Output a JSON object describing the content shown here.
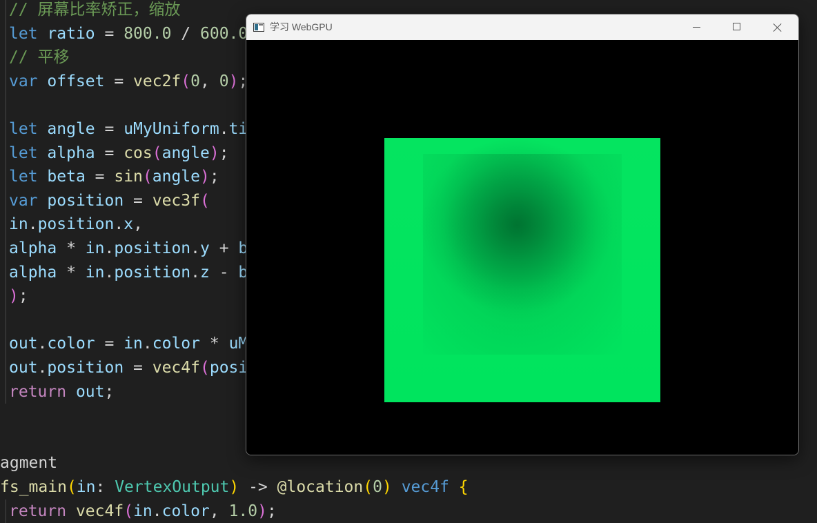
{
  "editor": {
    "lines": [
      {
        "guide": true,
        "tokens": [
          {
            "t": "// 屏幕比率矫正，缩放",
            "c": "cm"
          }
        ]
      },
      {
        "guide": true,
        "tokens": [
          {
            "t": "let",
            "c": "kw"
          },
          {
            "t": " ",
            "c": "plain"
          },
          {
            "t": "ratio",
            "c": "var"
          },
          {
            "t": " = ",
            "c": "op"
          },
          {
            "t": "800.0",
            "c": "num"
          },
          {
            "t": " / ",
            "c": "op"
          },
          {
            "t": "600.0",
            "c": "num"
          }
        ]
      },
      {
        "guide": true,
        "tokens": [
          {
            "t": "// 平移",
            "c": "cm"
          }
        ]
      },
      {
        "guide": true,
        "tokens": [
          {
            "t": "var",
            "c": "kw"
          },
          {
            "t": " ",
            "c": "plain"
          },
          {
            "t": "offset",
            "c": "var"
          },
          {
            "t": " = ",
            "c": "op"
          },
          {
            "t": "vec2f",
            "c": "fn"
          },
          {
            "t": "(",
            "c": "br2"
          },
          {
            "t": "0",
            "c": "num"
          },
          {
            "t": ", ",
            "c": "op"
          },
          {
            "t": "0",
            "c": "num"
          },
          {
            "t": ")",
            "c": "br2"
          },
          {
            "t": ";",
            "c": "op"
          }
        ]
      },
      {
        "guide": true,
        "tokens": []
      },
      {
        "guide": true,
        "tokens": [
          {
            "t": "let",
            "c": "kw"
          },
          {
            "t": " ",
            "c": "plain"
          },
          {
            "t": "angle",
            "c": "var"
          },
          {
            "t": " = ",
            "c": "op"
          },
          {
            "t": "uMyUniform",
            "c": "var"
          },
          {
            "t": ".",
            "c": "op"
          },
          {
            "t": "ti",
            "c": "var"
          }
        ]
      },
      {
        "guide": true,
        "tokens": [
          {
            "t": "let",
            "c": "kw"
          },
          {
            "t": " ",
            "c": "plain"
          },
          {
            "t": "alpha",
            "c": "var"
          },
          {
            "t": " = ",
            "c": "op"
          },
          {
            "t": "cos",
            "c": "fn"
          },
          {
            "t": "(",
            "c": "br2"
          },
          {
            "t": "angle",
            "c": "var"
          },
          {
            "t": ")",
            "c": "br2"
          },
          {
            "t": ";",
            "c": "op"
          }
        ]
      },
      {
        "guide": true,
        "tokens": [
          {
            "t": "let",
            "c": "kw"
          },
          {
            "t": " ",
            "c": "plain"
          },
          {
            "t": "beta",
            "c": "var"
          },
          {
            "t": " = ",
            "c": "op"
          },
          {
            "t": "sin",
            "c": "fn"
          },
          {
            "t": "(",
            "c": "br2"
          },
          {
            "t": "angle",
            "c": "var"
          },
          {
            "t": ")",
            "c": "br2"
          },
          {
            "t": ";",
            "c": "op"
          }
        ]
      },
      {
        "guide": true,
        "tokens": [
          {
            "t": "var",
            "c": "kw"
          },
          {
            "t": " ",
            "c": "plain"
          },
          {
            "t": "position",
            "c": "var"
          },
          {
            "t": " = ",
            "c": "op"
          },
          {
            "t": "vec3f",
            "c": "fn"
          },
          {
            "t": "(",
            "c": "br2"
          }
        ]
      },
      {
        "guide": true,
        "tokens": [
          {
            "t": "in",
            "c": "var"
          },
          {
            "t": ".",
            "c": "op"
          },
          {
            "t": "position",
            "c": "var"
          },
          {
            "t": ".",
            "c": "op"
          },
          {
            "t": "x",
            "c": "var"
          },
          {
            "t": ",",
            "c": "op"
          }
        ]
      },
      {
        "guide": true,
        "tokens": [
          {
            "t": "alpha",
            "c": "var"
          },
          {
            "t": " * ",
            "c": "op"
          },
          {
            "t": "in",
            "c": "var"
          },
          {
            "t": ".",
            "c": "op"
          },
          {
            "t": "position",
            "c": "var"
          },
          {
            "t": ".",
            "c": "op"
          },
          {
            "t": "y",
            "c": "var"
          },
          {
            "t": " + ",
            "c": "op"
          },
          {
            "t": "b",
            "c": "var"
          }
        ]
      },
      {
        "guide": true,
        "tokens": [
          {
            "t": "alpha",
            "c": "var"
          },
          {
            "t": " * ",
            "c": "op"
          },
          {
            "t": "in",
            "c": "var"
          },
          {
            "t": ".",
            "c": "op"
          },
          {
            "t": "position",
            "c": "var"
          },
          {
            "t": ".",
            "c": "op"
          },
          {
            "t": "z",
            "c": "var"
          },
          {
            "t": " - ",
            "c": "op"
          },
          {
            "t": "b",
            "c": "var"
          }
        ]
      },
      {
        "guide": true,
        "tokens": [
          {
            "t": ")",
            "c": "br2"
          },
          {
            "t": ";",
            "c": "op"
          }
        ]
      },
      {
        "guide": true,
        "tokens": []
      },
      {
        "guide": true,
        "tokens": [
          {
            "t": "out",
            "c": "var"
          },
          {
            "t": ".",
            "c": "op"
          },
          {
            "t": "color",
            "c": "var"
          },
          {
            "t": " = ",
            "c": "op"
          },
          {
            "t": "in",
            "c": "var"
          },
          {
            "t": ".",
            "c": "op"
          },
          {
            "t": "color",
            "c": "var"
          },
          {
            "t": " * ",
            "c": "op"
          },
          {
            "t": "uM",
            "c": "var"
          }
        ]
      },
      {
        "guide": true,
        "tokens": [
          {
            "t": "out",
            "c": "var"
          },
          {
            "t": ".",
            "c": "op"
          },
          {
            "t": "position",
            "c": "var"
          },
          {
            "t": " = ",
            "c": "op"
          },
          {
            "t": "vec4f",
            "c": "fn"
          },
          {
            "t": "(",
            "c": "br2"
          },
          {
            "t": "posi",
            "c": "var"
          }
        ]
      },
      {
        "guide": true,
        "tokens": [
          {
            "t": "return",
            "c": "ctl"
          },
          {
            "t": " ",
            "c": "plain"
          },
          {
            "t": "out",
            "c": "var"
          },
          {
            "t": ";",
            "c": "op"
          }
        ]
      },
      {
        "guide": false,
        "tokens": []
      },
      {
        "guide": false,
        "tokens": []
      },
      {
        "guide": false,
        "tokens": [
          {
            "t": "agment",
            "c": "plain"
          }
        ]
      },
      {
        "guide": false,
        "tokens": [
          {
            "t": "fs_main",
            "c": "fn"
          },
          {
            "t": "(",
            "c": "br1"
          },
          {
            "t": "in",
            "c": "var"
          },
          {
            "t": ": ",
            "c": "op"
          },
          {
            "t": "VertexOutput",
            "c": "ty"
          },
          {
            "t": ")",
            "c": "br1"
          },
          {
            "t": " -> ",
            "c": "op"
          },
          {
            "t": "@location",
            "c": "fn"
          },
          {
            "t": "(",
            "c": "br1"
          },
          {
            "t": "0",
            "c": "num"
          },
          {
            "t": ")",
            "c": "br1"
          },
          {
            "t": " ",
            "c": "plain"
          },
          {
            "t": "vec4f",
            "c": "kw"
          },
          {
            "t": " ",
            "c": "plain"
          },
          {
            "t": "{",
            "c": "br1"
          }
        ]
      },
      {
        "guide": true,
        "tokens": [
          {
            "t": "return",
            "c": "ctl"
          },
          {
            "t": " ",
            "c": "plain"
          },
          {
            "t": "vec4f",
            "c": "fn"
          },
          {
            "t": "(",
            "c": "br2"
          },
          {
            "t": "in",
            "c": "var"
          },
          {
            "t": ".",
            "c": "op"
          },
          {
            "t": "color",
            "c": "var"
          },
          {
            "t": ", ",
            "c": "op"
          },
          {
            "t": "1.0",
            "c": "num"
          },
          {
            "t": ")",
            "c": "br2"
          },
          {
            "t": ";",
            "c": "op"
          }
        ]
      }
    ]
  },
  "window": {
    "title": "学习 WebGPU",
    "controls": {
      "minimize": "minimize-icon",
      "maximize": "maximize-icon",
      "close": "close-icon"
    }
  },
  "colors": {
    "quad_edge": "#00e45e",
    "quad_center": "#006b32",
    "canvas_bg": "#000000",
    "editor_bg": "#1f1f1f"
  }
}
